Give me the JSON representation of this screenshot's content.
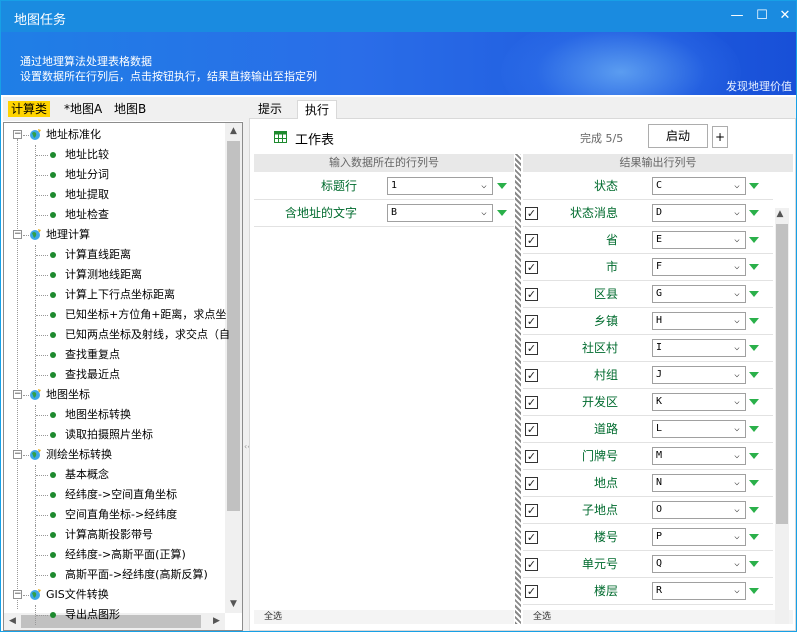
{
  "window": {
    "title": "地图任务",
    "minimize": "—",
    "maximize": "☐",
    "close": "✕"
  },
  "banner": {
    "line1": "通过地理算法处理表格数据",
    "line2": "设置数据所在行列后，点击按钮执行，结果直接输出至指定列",
    "discover": "发现地理价值"
  },
  "left_tabs": [
    "计算类",
    "*地图A",
    "地图B"
  ],
  "tree": [
    {
      "label": "地址标准化",
      "group": true
    },
    {
      "label": "地址比较",
      "group": false
    },
    {
      "label": "地址分词",
      "group": false
    },
    {
      "label": "地址提取",
      "group": false
    },
    {
      "label": "地址检查",
      "group": false
    },
    {
      "label": "地理计算",
      "group": true
    },
    {
      "label": "计算直线距离",
      "group": false
    },
    {
      "label": "计算测地线距离",
      "group": false
    },
    {
      "label": "计算上下行点坐标距离",
      "group": false
    },
    {
      "label": "已知坐标+方位角+距离，求点坐",
      "group": false
    },
    {
      "label": "已知两点坐标及射线，求交点（自",
      "group": false
    },
    {
      "label": "查找重复点",
      "group": false
    },
    {
      "label": "查找最近点",
      "group": false
    },
    {
      "label": "地图坐标",
      "group": true
    },
    {
      "label": "地图坐标转换",
      "group": false
    },
    {
      "label": "读取拍摄照片坐标",
      "group": false
    },
    {
      "label": "测绘坐标转换",
      "group": true
    },
    {
      "label": "基本概念",
      "group": false
    },
    {
      "label": "经纬度->空间直角坐标",
      "group": false
    },
    {
      "label": "空间直角坐标->经纬度",
      "group": false
    },
    {
      "label": "计算高斯投影带号",
      "group": false
    },
    {
      "label": "经纬度->高斯平面(正算)",
      "group": false
    },
    {
      "label": "高斯平面->经纬度(高斯反算)",
      "group": false
    },
    {
      "label": "GIS文件转换",
      "group": true
    },
    {
      "label": "导出点图形",
      "group": false
    }
  ],
  "right_tabs": [
    "提示",
    "执行"
  ],
  "toolbar": {
    "worksheet": "工作表",
    "progress": "完成 5/5",
    "start": "启动",
    "plus": "+"
  },
  "input_grid": {
    "header": "输入数据所在的行列号",
    "rows": [
      {
        "label": "标题行",
        "value": "1"
      },
      {
        "label": "含地址的文字",
        "value": "B"
      }
    ],
    "footer": "全选"
  },
  "output_grid": {
    "header": "结果输出行列号",
    "rows": [
      {
        "label": "状态",
        "value": "C",
        "checked": false
      },
      {
        "label": "状态消息",
        "value": "D",
        "checked": true
      },
      {
        "label": "省",
        "value": "E",
        "checked": true
      },
      {
        "label": "市",
        "value": "F",
        "checked": true
      },
      {
        "label": "区县",
        "value": "G",
        "checked": true
      },
      {
        "label": "乡镇",
        "value": "H",
        "checked": true
      },
      {
        "label": "社区村",
        "value": "I",
        "checked": true
      },
      {
        "label": "村组",
        "value": "J",
        "checked": true
      },
      {
        "label": "开发区",
        "value": "K",
        "checked": true
      },
      {
        "label": "道路",
        "value": "L",
        "checked": true
      },
      {
        "label": "门牌号",
        "value": "M",
        "checked": true
      },
      {
        "label": "地点",
        "value": "N",
        "checked": true
      },
      {
        "label": "子地点",
        "value": "O",
        "checked": true
      },
      {
        "label": "楼号",
        "value": "P",
        "checked": true
      },
      {
        "label": "单元号",
        "value": "Q",
        "checked": true
      },
      {
        "label": "楼层",
        "value": "R",
        "checked": true
      }
    ],
    "footer": "全选"
  },
  "colors": {
    "title_bar": "#1a8be0",
    "banner": "#2a6de8",
    "tab_highlight": "#ffd400",
    "label_green": "#006b2e",
    "arrow_green": "#2ab04a"
  }
}
